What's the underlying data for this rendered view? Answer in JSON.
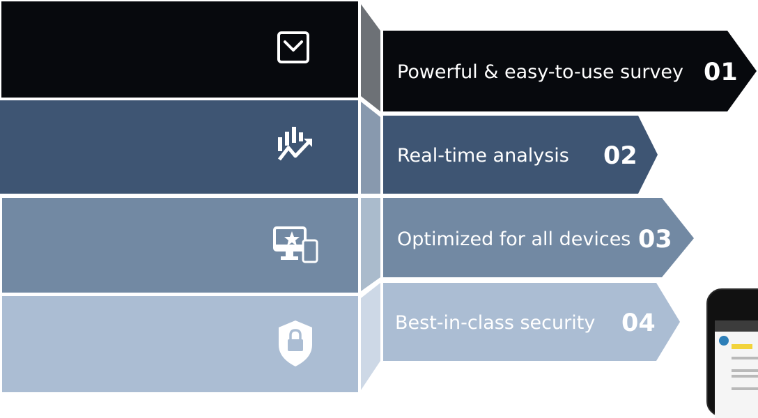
{
  "features": [
    {
      "label": "Powerful & easy-to-use survey",
      "number": "01",
      "icon": "checkbox-down-icon",
      "color": "#07090d",
      "panel_color": "#07090d",
      "connector_color": "#6d7176"
    },
    {
      "label": "Real-time analysis",
      "number": "02",
      "icon": "analytics-chart-icon",
      "color": "#3e5573",
      "panel_color": "#3e5573",
      "connector_color": "#8899ae"
    },
    {
      "label": "Optimized for all devices",
      "number": "03",
      "icon": "multi-device-icon",
      "color": "#7289a3",
      "panel_color": "#7289a3",
      "connector_color": "#aabbcc"
    },
    {
      "label": "Best-in-class security",
      "number": "04",
      "icon": "shield-lock-icon",
      "color": "#abbdd3",
      "panel_color": "#abbdd3",
      "connector_color": "#cdd8e6"
    }
  ]
}
